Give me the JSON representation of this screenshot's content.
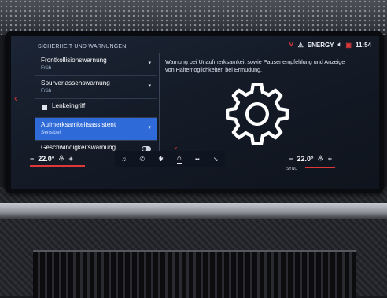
{
  "header": {
    "title": "SICHERHEIT UND WARNUNGEN",
    "energy": "ENERGY",
    "time": "11:54"
  },
  "menu": {
    "items": [
      {
        "label": "Frontkollisionswarnung",
        "sub": "Früh"
      },
      {
        "label": "Spurverlassenswarnung",
        "sub": "Früh"
      },
      {
        "label": "Lenkeingriff"
      },
      {
        "label": "Aufmerksamkeitsassistent",
        "sub": "Sensibel"
      },
      {
        "label": "Geschwindigkeitswarnung"
      }
    ]
  },
  "detail": {
    "description": "Warnung bei Unaufmerksamkeit sowie Pausenempfehlung und Anzeige von Haltemöglichkeiten bei Ermüdung."
  },
  "climate": {
    "left_temp": "22.0°",
    "right_temp": "22.0°",
    "sync": "SYNC",
    "minus": "−",
    "plus": "+"
  },
  "colors": {
    "accent": "#2f6bd8",
    "warning": "#e0383a"
  }
}
